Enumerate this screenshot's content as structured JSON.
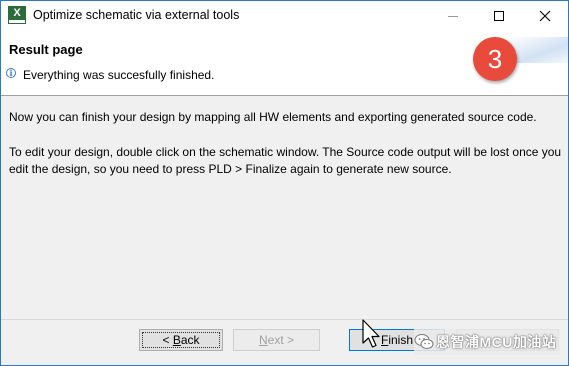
{
  "window": {
    "title": "Optimize schematic via external tools",
    "icon": "xilinx-app-icon",
    "icon_letter": "X",
    "controls": [
      "minimize-icon",
      "maximize-icon",
      "close-icon"
    ]
  },
  "header": {
    "title": "Result page",
    "message": "Everything was succesfully finished."
  },
  "annotation": {
    "step": "3",
    "color": "#e84a3c"
  },
  "body": {
    "paragraph1": "Now you can finish your design by mapping all HW elements and exporting generated source code.",
    "paragraph2": "To edit your design, double click on the schematic window. The Source code output will be lost once you edit the design, so you need to press PLD > Finalize again to generate new source."
  },
  "buttons": {
    "back": {
      "mnemonic": "B",
      "text": "ack",
      "prefix": "< "
    },
    "next": {
      "mnemonic": "N",
      "text": "ext",
      "suffix": " >",
      "enabled": false
    },
    "finish": {
      "mnemonic": "F",
      "text": "inish"
    }
  },
  "watermark": {
    "text": "恩智浦MCU加油站",
    "icon": "wechat-icon"
  },
  "colors": {
    "accent": "#0078d7",
    "window_border": "#2b78c8"
  }
}
